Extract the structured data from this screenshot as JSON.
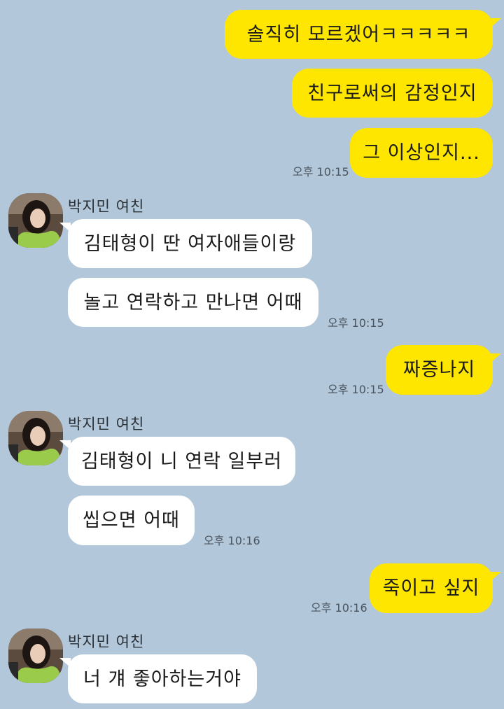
{
  "colors": {
    "background": "#b2c7d9",
    "mine_bubble": "#fee600",
    "theirs_bubble": "#ffffff"
  },
  "sender_name": "박지민 여친",
  "messages": {
    "m1": "솔직히 모르겠어ㅋㅋㅋㅋㅋ",
    "m2": "친구로써의 감정인지",
    "m3": "그 이상인지...",
    "t1": "오후 10:15",
    "m4": "김태형이 딴 여자애들이랑",
    "m5": "놀고 연락하고 만나면 어때",
    "t2": "오후 10:15",
    "m6": "짜증나지",
    "t3": "오후 10:15",
    "m7": "김태형이 니 연락 일부러",
    "m8": "씹으면 어때",
    "t4": "오후 10:16",
    "m9": "죽이고 싶지",
    "t5": "오후 10:16",
    "m10": "너 걔 좋아하는거야"
  },
  "icons": {
    "avatar": "profile-avatar-icon"
  }
}
